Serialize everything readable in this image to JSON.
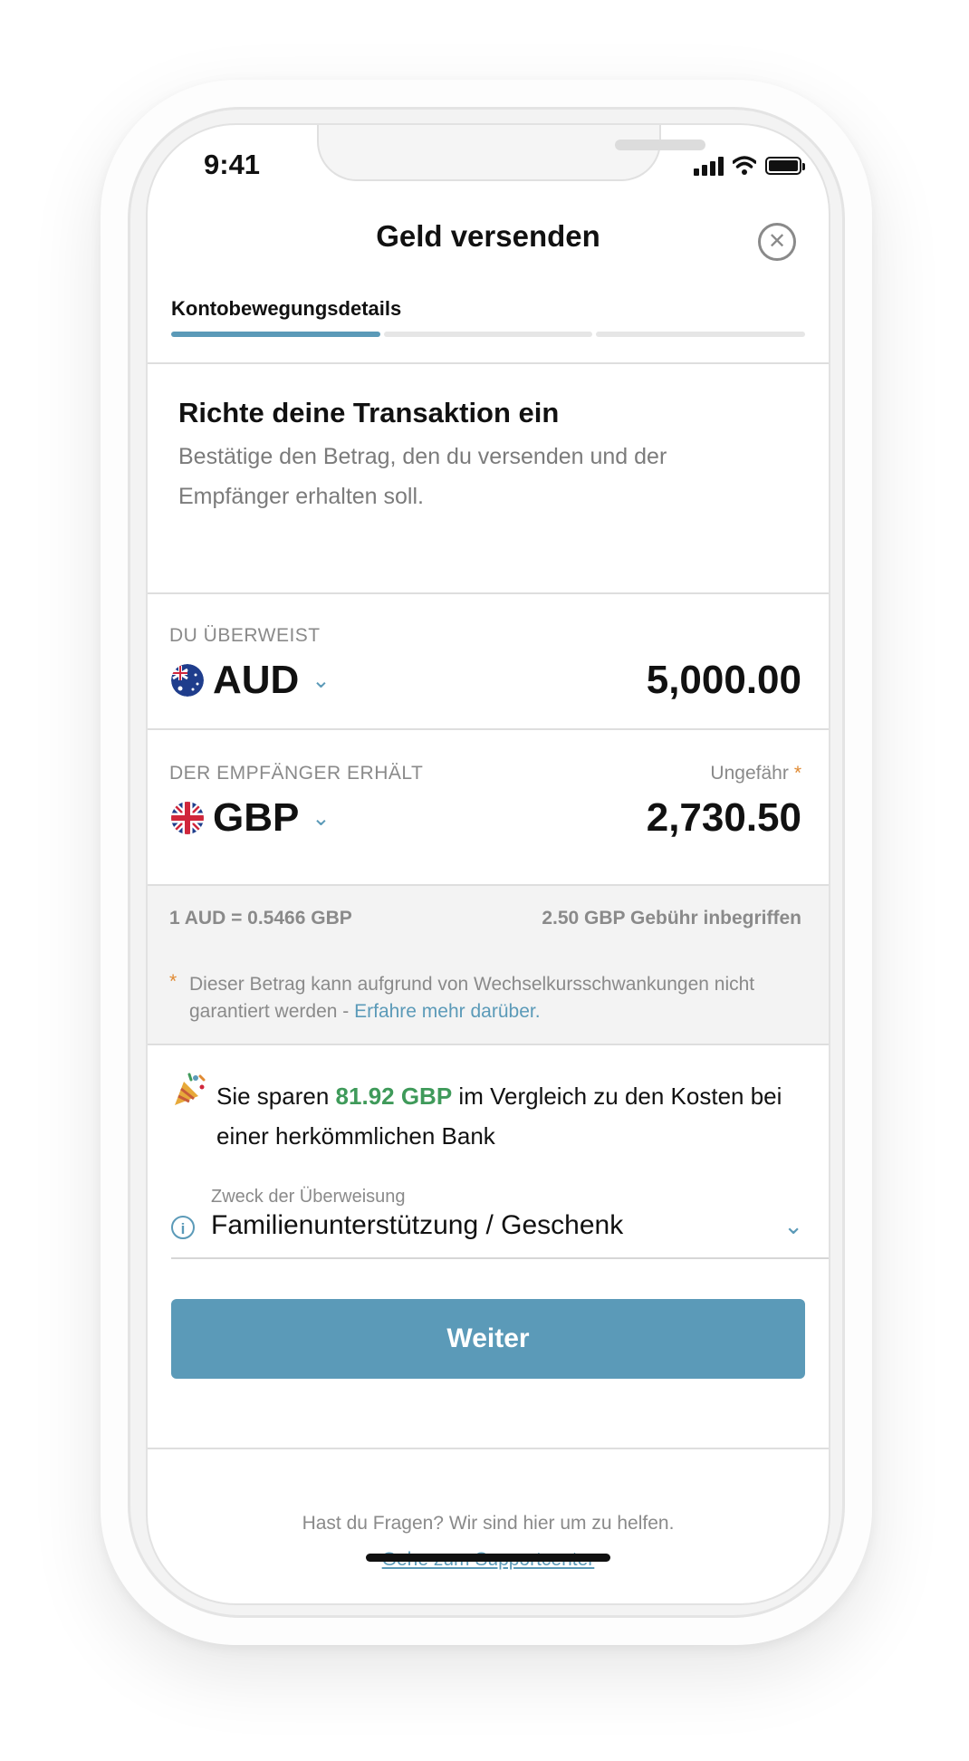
{
  "status_bar": {
    "time": "9:41"
  },
  "header": {
    "title": "Geld versenden",
    "close_icon": "close-circle-icon"
  },
  "stepper": {
    "label": "Kontobewegungsdetails",
    "steps": 3,
    "active_step": 1
  },
  "intro": {
    "title": "Richte deine Transaktion ein",
    "text": "Bestätige den Betrag, den du versenden und der Empfänger erhalten soll."
  },
  "send": {
    "label": "DU ÜBERWEIST",
    "currency": "AUD",
    "amount": "5,000.00",
    "flag_icon": "australia-flag-icon"
  },
  "receive": {
    "label": "DER EMPFÄNGER ERHÄLT",
    "approx_label": "Ungefähr",
    "approx_mark": "*",
    "currency": "GBP",
    "amount": "2,730.50",
    "flag_icon": "uk-flag-icon"
  },
  "rate": {
    "exchange": "1 AUD = 0.5466 GBP",
    "fee": "2.50 GBP Gebühr inbegriffen"
  },
  "note": {
    "mark": "*",
    "text": "Dieser Betrag kann aufgrund von Wechselkursschwankungen nicht garantiert werden -",
    "link": "Erfahre mehr darüber."
  },
  "savings": {
    "icon": "party-popper-icon",
    "prefix": "Sie sparen",
    "amount": "81.92 GBP",
    "suffix": "im Vergleich zu den Kosten bei einer herkömmlichen Bank"
  },
  "purpose": {
    "label": "Zweck der Überweisung",
    "value": "Familienunterstützung / Geschenk"
  },
  "actions": {
    "continue_label": "Weiter"
  },
  "footer": {
    "question": "Hast du Fragen? Wir sind hier um zu helfen.",
    "link": "Gehe zum Supportcenter"
  },
  "colors": {
    "accent": "#5b9ab8",
    "savings_green": "#3f9a5a",
    "asterisk_orange": "#e08a33",
    "muted_text": "#8a8a8a"
  }
}
